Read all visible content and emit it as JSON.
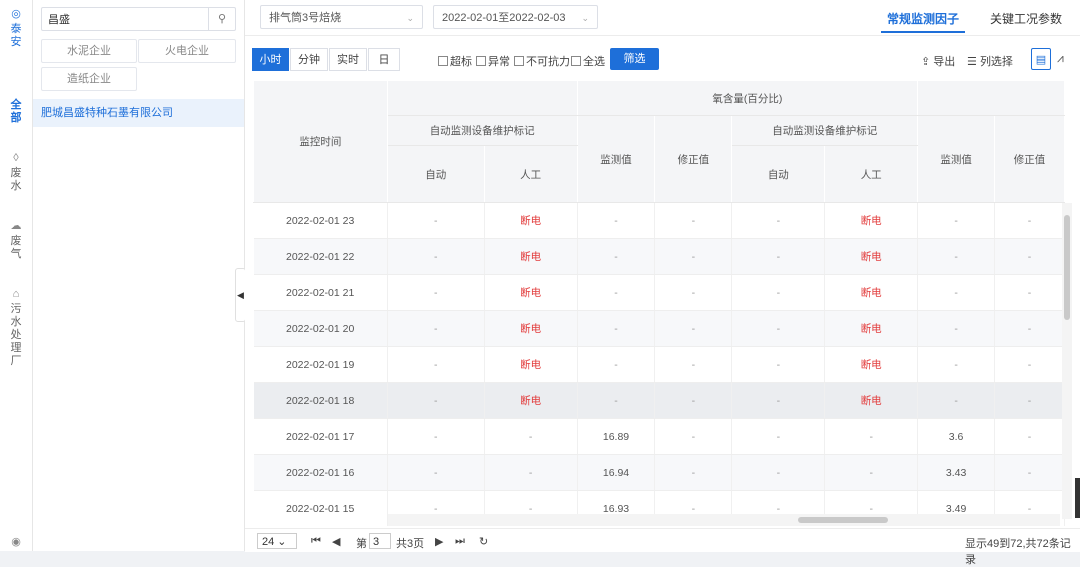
{
  "rail": {
    "region": "泰安",
    "all": "全部",
    "waste_water": "废水",
    "waste_gas": "废气",
    "sewage": "污水处理厂"
  },
  "panel": {
    "search_value": "昌盛",
    "categories": [
      "水泥企业",
      "火电企业",
      "造纸企业"
    ],
    "company": "肥城昌盛特种石墨有限公司"
  },
  "filters": {
    "outlet": "排气筒3号焙烧",
    "date_range": "2022-02-01至2022-02-03"
  },
  "tabs": {
    "regular": "常规监测因子",
    "key_params": "关键工况参数"
  },
  "granularity": [
    "小时",
    "分钟",
    "实时",
    "日"
  ],
  "checkboxes": [
    "超标",
    "异常",
    "不可抗力",
    "全选"
  ],
  "filter_button": "筛选",
  "tools": {
    "export": "导出",
    "columns": "列选择"
  },
  "table": {
    "header_time": "监控时间",
    "group_oxygen": "氧含量(百分比)",
    "group_maintenance": "自动监测设备维护标记",
    "col_auto": "自动",
    "col_manual": "人工",
    "col_measured": "监测值",
    "col_corrected": "修正值",
    "rows": [
      {
        "time": "2022-02-01 23",
        "c1": "-",
        "c2": "断电",
        "c3": "-",
        "c4": "-",
        "c5": "-",
        "c6": "断电",
        "c7": "-",
        "c8": "-"
      },
      {
        "time": "2022-02-01 22",
        "c1": "-",
        "c2": "断电",
        "c3": "-",
        "c4": "-",
        "c5": "-",
        "c6": "断电",
        "c7": "-",
        "c8": "-"
      },
      {
        "time": "2022-02-01 21",
        "c1": "-",
        "c2": "断电",
        "c3": "-",
        "c4": "-",
        "c5": "-",
        "c6": "断电",
        "c7": "-",
        "c8": "-"
      },
      {
        "time": "2022-02-01 20",
        "c1": "-",
        "c2": "断电",
        "c3": "-",
        "c4": "-",
        "c5": "-",
        "c6": "断电",
        "c7": "-",
        "c8": "-"
      },
      {
        "time": "2022-02-01 19",
        "c1": "-",
        "c2": "断电",
        "c3": "-",
        "c4": "-",
        "c5": "-",
        "c6": "断电",
        "c7": "-",
        "c8": "-"
      },
      {
        "time": "2022-02-01 18",
        "c1": "-",
        "c2": "断电",
        "c3": "-",
        "c4": "-",
        "c5": "-",
        "c6": "断电",
        "c7": "-",
        "c8": "-"
      },
      {
        "time": "2022-02-01 17",
        "c1": "-",
        "c2": "-",
        "c3": "16.89",
        "c4": "-",
        "c5": "-",
        "c6": "-",
        "c7": "3.6",
        "c8": "-"
      },
      {
        "time": "2022-02-01 16",
        "c1": "-",
        "c2": "-",
        "c3": "16.94",
        "c4": "-",
        "c5": "-",
        "c6": "-",
        "c7": "3.43",
        "c8": "-"
      },
      {
        "time": "2022-02-01 15",
        "c1": "-",
        "c2": "-",
        "c3": "16.93",
        "c4": "-",
        "c5": "-",
        "c6": "-",
        "c7": "3.49",
        "c8": "-"
      }
    ]
  },
  "pager": {
    "page_size": "24",
    "page_prefix": "第",
    "page_current": "3",
    "page_total": "共3页",
    "summary": "显示49到72,共72条记录"
  },
  "colors": {
    "accent": "#1e6fd9",
    "outage": "#e23b3b"
  }
}
